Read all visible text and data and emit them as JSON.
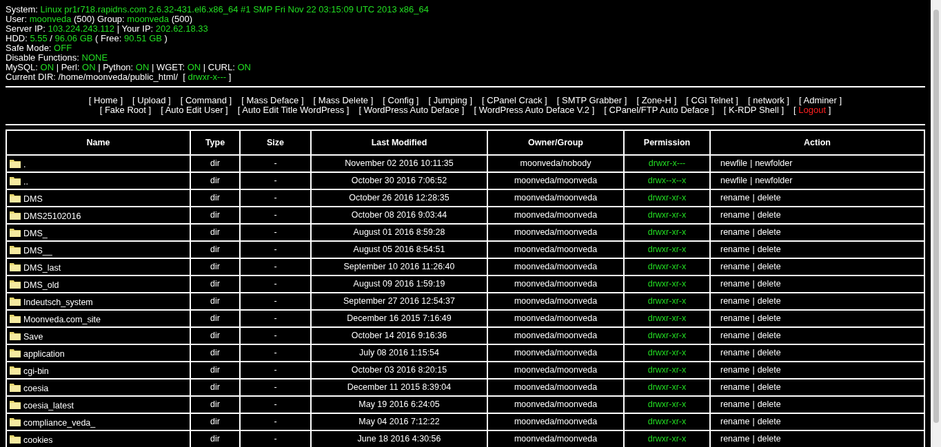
{
  "info_lines": [
    [
      {
        "text": "System: ",
        "kind": "label"
      },
      {
        "text": "Linux pr1r718.rapidns.com 2.6.32-431.el6.x86_64 #1 SMP Fri Nov 22 03:15:09 UTC 2013 x86_64",
        "kind": "value"
      }
    ],
    [
      {
        "text": "User: ",
        "kind": "label"
      },
      {
        "text": "moonveda",
        "kind": "value"
      },
      {
        "text": " (500) Group: ",
        "kind": "label"
      },
      {
        "text": "moonveda",
        "kind": "value"
      },
      {
        "text": " (500)",
        "kind": "label"
      }
    ],
    [
      {
        "text": "Server IP: ",
        "kind": "label"
      },
      {
        "text": "103.224.243.112",
        "kind": "value"
      },
      {
        "text": " | Your IP: ",
        "kind": "label"
      },
      {
        "text": "202.62.18.33",
        "kind": "value"
      }
    ],
    [
      {
        "text": "HDD: ",
        "kind": "label"
      },
      {
        "text": "5.55",
        "kind": "value"
      },
      {
        "text": " / ",
        "kind": "label"
      },
      {
        "text": "96.06 GB",
        "kind": "value"
      },
      {
        "text": " ( Free: ",
        "kind": "label"
      },
      {
        "text": "90.51 GB",
        "kind": "value"
      },
      {
        "text": " )",
        "kind": "label"
      }
    ],
    [
      {
        "text": "Safe Mode: ",
        "kind": "label"
      },
      {
        "text": "OFF",
        "kind": "value"
      }
    ],
    [
      {
        "text": "Disable Functions: ",
        "kind": "label"
      },
      {
        "text": "NONE",
        "kind": "value"
      }
    ],
    [
      {
        "text": "MySQL: ",
        "kind": "label"
      },
      {
        "text": "ON",
        "kind": "value"
      },
      {
        "text": " | Perl: ",
        "kind": "label"
      },
      {
        "text": "ON",
        "kind": "value"
      },
      {
        "text": " | Python: ",
        "kind": "label"
      },
      {
        "text": "ON",
        "kind": "value"
      },
      {
        "text": " | WGET: ",
        "kind": "label"
      },
      {
        "text": "ON",
        "kind": "value"
      },
      {
        "text": " | CURL: ",
        "kind": "label"
      },
      {
        "text": "ON",
        "kind": "value"
      }
    ],
    [
      {
        "text": "Current DIR: /home/moonveda/public_html/  [ ",
        "kind": "label"
      },
      {
        "text": "drwxr-x---",
        "kind": "value"
      },
      {
        "text": " ]",
        "kind": "label"
      }
    ]
  ],
  "nav_rows": [
    [
      {
        "open": "[",
        "label": "Home",
        "close": "]",
        "kind": "normal"
      },
      {
        "open": "[",
        "label": "Upload",
        "close": "]",
        "kind": "normal"
      },
      {
        "open": "[",
        "label": "Command",
        "close": "]",
        "kind": "normal"
      },
      {
        "open": "[",
        "label": "Mass Deface",
        "close": "]",
        "kind": "normal"
      },
      {
        "open": "[",
        "label": "Mass Delete",
        "close": "]",
        "kind": "normal"
      },
      {
        "open": "[",
        "label": "Config",
        "close": "]",
        "kind": "normal"
      },
      {
        "open": "[",
        "label": "Jumping",
        "close": "]",
        "kind": "normal"
      },
      {
        "open": "[",
        "label": "CPanel Crack",
        "close": "]",
        "kind": "normal"
      },
      {
        "open": "[",
        "label": "SMTP Grabber",
        "close": "]",
        "kind": "normal"
      },
      {
        "open": "[",
        "label": "Zone-H",
        "close": "]",
        "kind": "normal"
      },
      {
        "open": "[",
        "label": "CGI Telnet",
        "close": "]",
        "kind": "normal"
      },
      {
        "open": "[",
        "label": "network",
        "close": "]",
        "kind": "normal"
      },
      {
        "open": "[",
        "label": "Adminer",
        "close": "]",
        "kind": "normal"
      }
    ],
    [
      {
        "open": "[",
        "label": "Fake Root",
        "close": "]",
        "kind": "normal"
      },
      {
        "open": "[",
        "label": "Auto Edit User",
        "close": "]",
        "kind": "normal"
      },
      {
        "open": "[",
        "label": "Auto Edit Title WordPress",
        "close": "]",
        "kind": "normal"
      },
      {
        "open": "[",
        "label": "WordPress Auto Deface",
        "close": "]",
        "kind": "normal"
      },
      {
        "open": "[",
        "label": "WordPress Auto Deface V.2",
        "close": "]",
        "kind": "normal"
      },
      {
        "open": "[",
        "label": "CPanel/FTP Auto Deface",
        "close": "]",
        "kind": "normal"
      },
      {
        "open": "[",
        "label": "K-RDP Shell",
        "close": "]",
        "kind": "normal"
      },
      {
        "open": "[",
        "label": "Logout",
        "close": "]",
        "kind": "danger"
      }
    ]
  ],
  "table": {
    "columns": [
      "Name",
      "Type",
      "Size",
      "Last Modified",
      "Owner/Group",
      "Permission",
      "Action"
    ],
    "rows": [
      {
        "name": ".",
        "type": "dir",
        "size": "-",
        "modified": "November 02 2016 10:11:35",
        "owner": "moonveda/nobody",
        "permission": "drwxr-x---",
        "actions": [
          "newfile",
          "newfolder"
        ],
        "separator": "|"
      },
      {
        "name": "..",
        "type": "dir",
        "size": "-",
        "modified": "October 30 2016 7:06:52",
        "owner": "moonveda/moonveda",
        "permission": "drwx--x--x",
        "actions": [
          "newfile",
          "newfolder"
        ],
        "separator": "|"
      },
      {
        "name": "DMS",
        "type": "dir",
        "size": "-",
        "modified": "October 26 2016 12:28:35",
        "owner": "moonveda/moonveda",
        "permission": "drwxr-xr-x",
        "actions": [
          "rename",
          "delete"
        ],
        "separator": "|"
      },
      {
        "name": "DMS25102016",
        "type": "dir",
        "size": "-",
        "modified": "October 08 2016 9:03:44",
        "owner": "moonveda/moonveda",
        "permission": "drwxr-xr-x",
        "actions": [
          "rename",
          "delete"
        ],
        "separator": "|"
      },
      {
        "name": "DMS_",
        "type": "dir",
        "size": "-",
        "modified": "August 01 2016 8:59:28",
        "owner": "moonveda/moonveda",
        "permission": "drwxr-xr-x",
        "actions": [
          "rename",
          "delete"
        ],
        "separator": "|"
      },
      {
        "name": "DMS__",
        "type": "dir",
        "size": "-",
        "modified": "August 05 2016 8:54:51",
        "owner": "moonveda/moonveda",
        "permission": "drwxr-xr-x",
        "actions": [
          "rename",
          "delete"
        ],
        "separator": "|"
      },
      {
        "name": "DMS_last",
        "type": "dir",
        "size": "-",
        "modified": "September 10 2016 11:26:40",
        "owner": "moonveda/moonveda",
        "permission": "drwxr-xr-x",
        "actions": [
          "rename",
          "delete"
        ],
        "separator": "|"
      },
      {
        "name": "DMS_old",
        "type": "dir",
        "size": "-",
        "modified": "August 09 2016 1:59:19",
        "owner": "moonveda/moonveda",
        "permission": "drwxr-xr-x",
        "actions": [
          "rename",
          "delete"
        ],
        "separator": "|"
      },
      {
        "name": "Indeutsch_system",
        "type": "dir",
        "size": "-",
        "modified": "September 27 2016 12:54:37",
        "owner": "moonveda/moonveda",
        "permission": "drwxr-xr-x",
        "actions": [
          "rename",
          "delete"
        ],
        "separator": "|"
      },
      {
        "name": "Moonveda.com_site",
        "type": "dir",
        "size": "-",
        "modified": "December 16 2015 7:16:49",
        "owner": "moonveda/moonveda",
        "permission": "drwxr-xr-x",
        "actions": [
          "rename",
          "delete"
        ],
        "separator": "|"
      },
      {
        "name": "Save",
        "type": "dir",
        "size": "-",
        "modified": "October 14 2016 9:16:36",
        "owner": "moonveda/moonveda",
        "permission": "drwxr-xr-x",
        "actions": [
          "rename",
          "delete"
        ],
        "separator": "|"
      },
      {
        "name": "application",
        "type": "dir",
        "size": "-",
        "modified": "July 08 2016 1:15:54",
        "owner": "moonveda/moonveda",
        "permission": "drwxr-xr-x",
        "actions": [
          "rename",
          "delete"
        ],
        "separator": "|"
      },
      {
        "name": "cgi-bin",
        "type": "dir",
        "size": "-",
        "modified": "October 03 2016 8:20:15",
        "owner": "moonveda/moonveda",
        "permission": "drwxr-xr-x",
        "actions": [
          "rename",
          "delete"
        ],
        "separator": "|"
      },
      {
        "name": "coesia",
        "type": "dir",
        "size": "-",
        "modified": "December 11 2015 8:39:04",
        "owner": "moonveda/moonveda",
        "permission": "drwxr-xr-x",
        "actions": [
          "rename",
          "delete"
        ],
        "separator": "|"
      },
      {
        "name": "coesia_latest",
        "type": "dir",
        "size": "-",
        "modified": "May 19 2016 6:24:05",
        "owner": "moonveda/moonveda",
        "permission": "drwxr-xr-x",
        "actions": [
          "rename",
          "delete"
        ],
        "separator": "|"
      },
      {
        "name": "compliance_veda_",
        "type": "dir",
        "size": "-",
        "modified": "May 04 2016 7:12:22",
        "owner": "moonveda/moonveda",
        "permission": "drwxr-xr-x",
        "actions": [
          "rename",
          "delete"
        ],
        "separator": "|"
      },
      {
        "name": "cookies",
        "type": "dir",
        "size": "-",
        "modified": "June 18 2016 4:30:56",
        "owner": "moonveda/moonveda",
        "permission": "drwxr-xr-x",
        "actions": [
          "rename",
          "delete"
        ],
        "separator": "|"
      }
    ]
  }
}
